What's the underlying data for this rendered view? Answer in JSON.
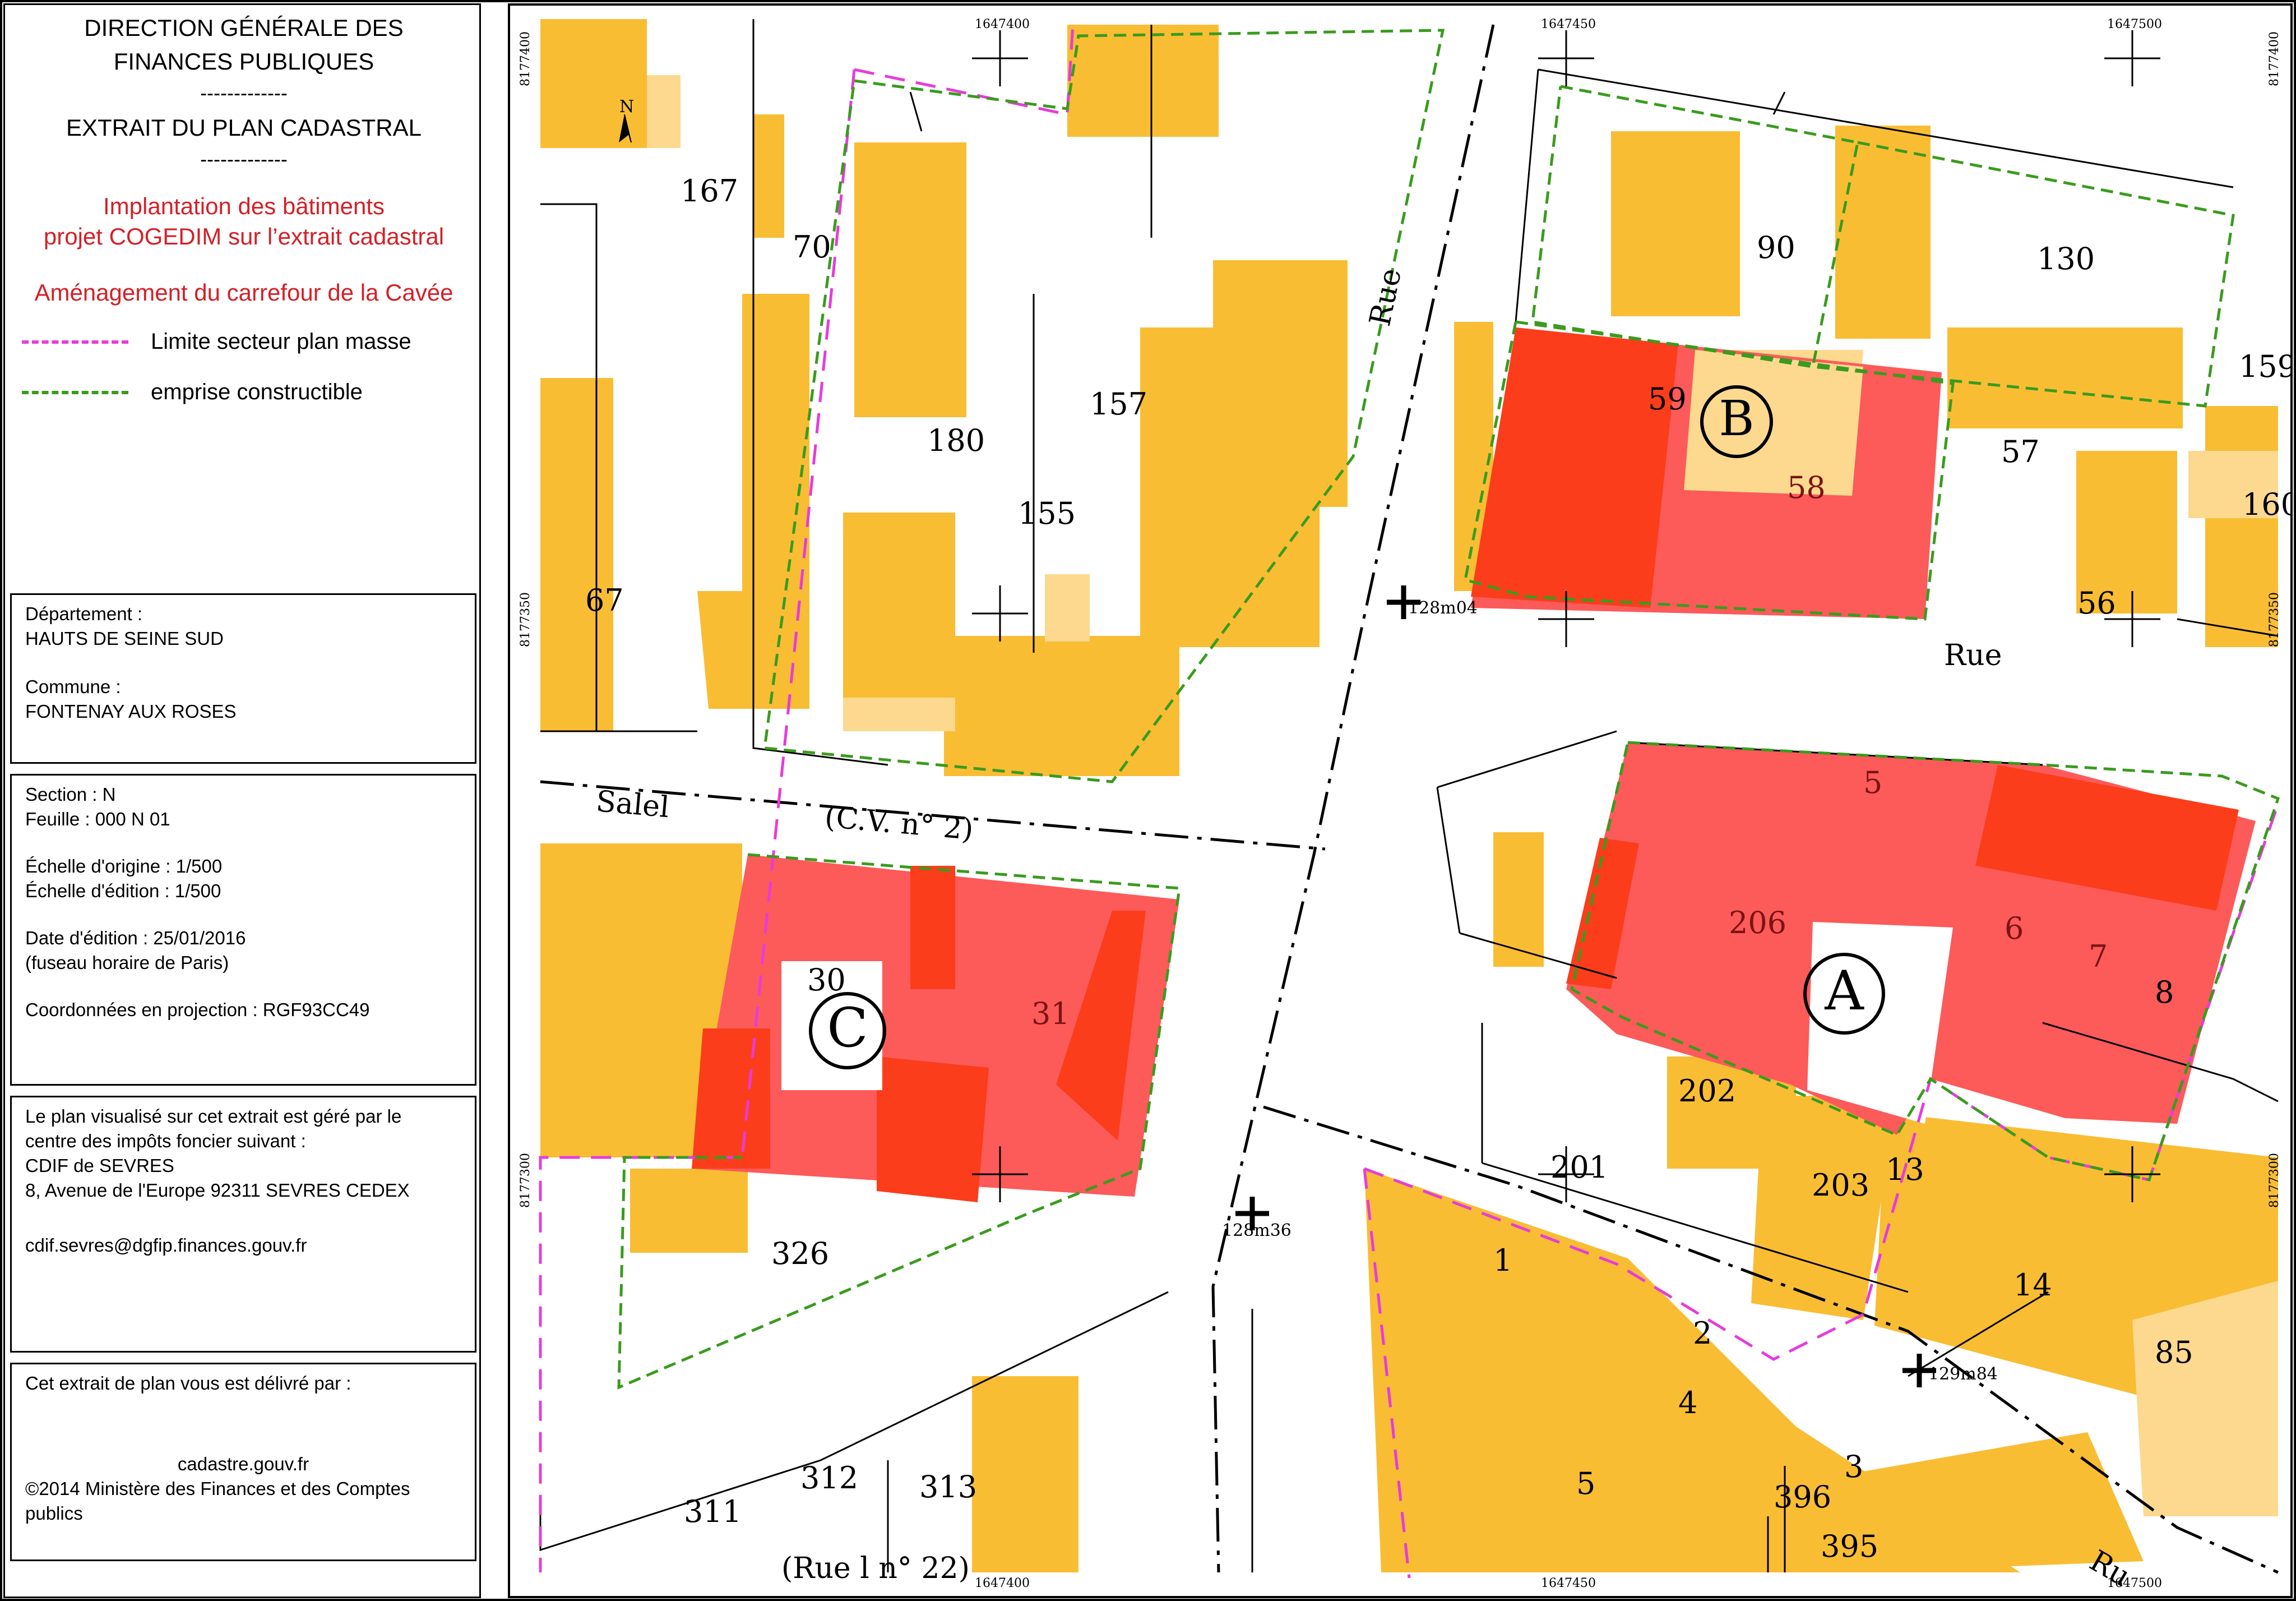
{
  "header": {
    "line1": "DIRECTION GÉNÉRALE DES",
    "line2": "FINANCES PUBLIQUES",
    "sep1": "-------------",
    "line3": "EXTRAIT DU PLAN CADASTRAL",
    "sep2": "-------------",
    "red1": "Implantation des bâtiments",
    "red2": "projet COGEDIM sur l’extrait cadastral",
    "red3": "Aménagement du carrefour de la Cavée"
  },
  "legend": {
    "item1": "Limite secteur plan masse",
    "item2": "emprise constructible",
    "color1": "#e63cd9",
    "color2": "#3a9b1e"
  },
  "info_dept": {
    "label1": "Département :",
    "value1": "HAUTS DE SEINE SUD",
    "label2": "Commune :",
    "value2": "FONTENAY AUX ROSES"
  },
  "info_section": {
    "section": "Section : N",
    "feuille": "Feuille : 000 N 01",
    "echelle_origine": "Échelle d'origine : 1/500",
    "echelle_edition": "Échelle d'édition : 1/500",
    "date": "Date d'édition : 25/01/2016",
    "fuseau": "(fuseau horaire de Paris)",
    "coord": "Coordonnées en projection : RGF93CC49"
  },
  "info_centre": {
    "l1": "Le plan visualisé sur cet extrait est géré par le",
    "l2": "centre des impôts foncier suivant :",
    "l3": "CDIF de SEVRES",
    "l4": "8, Avenue de l'Europe 92311 SEVRES  CEDEX",
    "l5": "cdif.sevres@dgfip.finances.gouv.fr"
  },
  "info_delivery": {
    "l1": "Cet extrait de plan vous est délivré par :",
    "l2": "cadastre.gouv.fr",
    "l3": "©2014 Ministère des Finances et des Comptes",
    "l4": "publics"
  },
  "map": {
    "colors": {
      "building": "#f9bd34",
      "building_light": "#fcd98f",
      "project": "#fd5a5a",
      "project_dark": "#fb3d1b"
    },
    "coords_top": [
      "1647400",
      "1647450",
      "1647500"
    ],
    "coords_bottom": [
      "1647400",
      "1647450",
      "1647500"
    ],
    "coords_side": [
      "8177400",
      "8177350",
      "8177300"
    ],
    "parcels": [
      "167",
      "70",
      "180",
      "157",
      "155",
      "67",
      "90",
      "130",
      "159",
      "59",
      "58",
      "57",
      "160",
      "56",
      "206",
      "5",
      "6",
      "7",
      "8",
      "202",
      "201",
      "203",
      "13",
      "14",
      "85",
      "30",
      "31",
      "326",
      "1",
      "2",
      "4",
      "3",
      "5",
      "396",
      "395",
      "312",
      "313",
      "311"
    ],
    "streets": [
      "Rue",
      "Rue",
      "Salel",
      "(C.V. n° 2)",
      "Ru",
      "(Rue l n° 22)"
    ],
    "altitudes": [
      "128m04",
      "128m36",
      "129m84"
    ],
    "lots": [
      "A",
      "B",
      "C"
    ],
    "north": "N"
  }
}
